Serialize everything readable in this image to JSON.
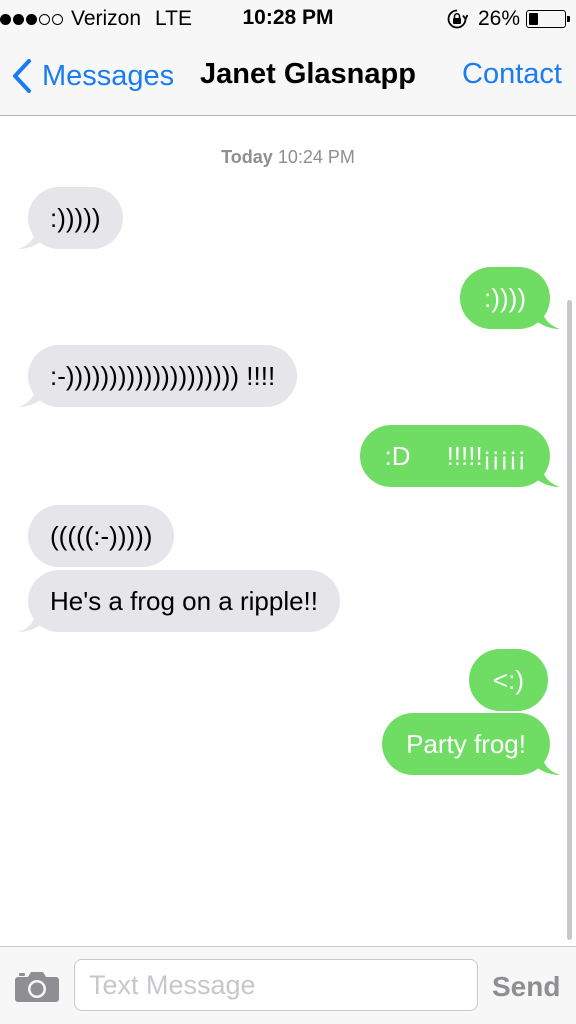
{
  "status_bar": {
    "signal_full": 3,
    "signal_total": 5,
    "carrier": "Verizon",
    "network": "LTE",
    "time": "10:28 PM",
    "battery_percent_label": "26%",
    "battery_level": 0.26
  },
  "nav": {
    "back_label": "Messages",
    "title": "Janet Glasnapp",
    "contact_label": "Contact"
  },
  "timestamp": {
    "day": "Today",
    "time": "10:24 PM"
  },
  "messages": [
    {
      "direction": "in",
      "text": ":)))))"
    },
    {
      "direction": "out",
      "text": ":))))"
    },
    {
      "direction": "in",
      "text": ":-)))))))))))))))))))) !!!!"
    },
    {
      "direction": "out",
      "text": ":D     !!!!!¡¡¡¡¡"
    },
    {
      "direction": "in",
      "text": "(((((:-)))))"
    },
    {
      "direction": "in",
      "text": "He's a frog on a ripple!!"
    },
    {
      "direction": "out",
      "text": "<:)"
    },
    {
      "direction": "out",
      "text": "Party frog!"
    }
  ],
  "composer": {
    "placeholder": "Text Message",
    "send_label": "Send"
  },
  "colors": {
    "ios_blue": "#1a7cf2",
    "outgoing_bubble": "#6fdc63",
    "incoming_bubble": "#e5e5ea",
    "send_disabled": "#8e8e93"
  },
  "icons": {
    "back": "chevron-left-icon",
    "camera": "camera-icon",
    "orientation_lock": "orientation-lock-icon",
    "battery": "battery-icon"
  }
}
